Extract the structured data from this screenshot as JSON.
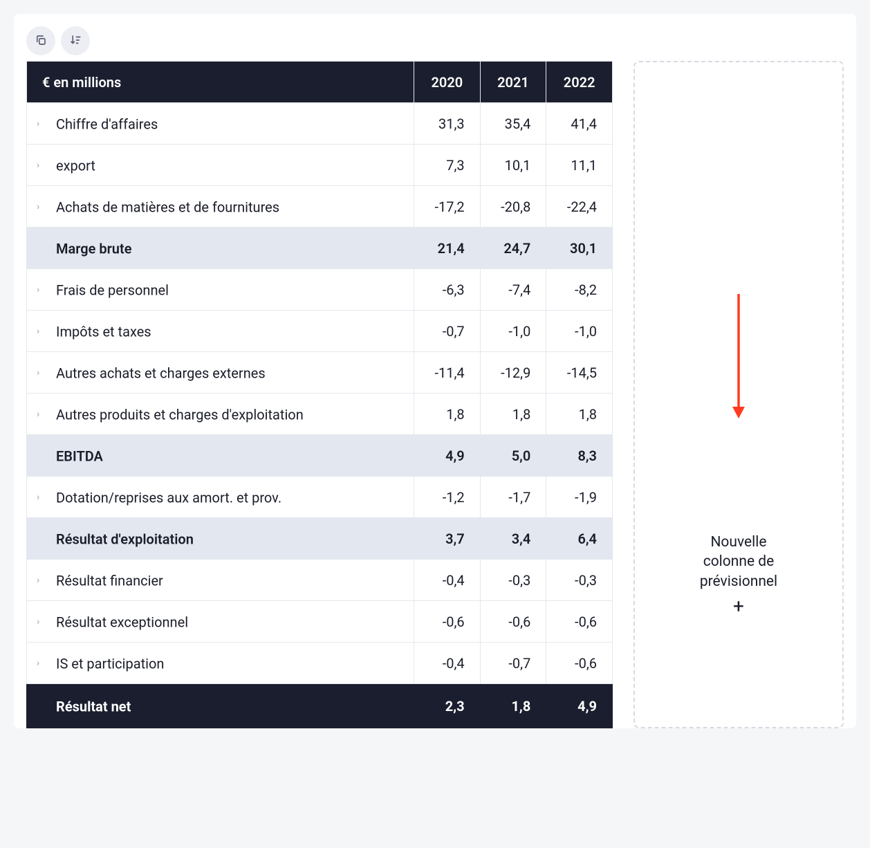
{
  "header": {
    "row_label": "€ en millions",
    "years": [
      "2020",
      "2021",
      "2022"
    ]
  },
  "rows": [
    {
      "type": "data",
      "label": "Chiffre d'affaires",
      "v": [
        "31,3",
        "35,4",
        "41,4"
      ]
    },
    {
      "type": "data",
      "label": "export",
      "v": [
        "7,3",
        "10,1",
        "11,1"
      ]
    },
    {
      "type": "data",
      "label": "Achats de matières et de fournitures",
      "v": [
        "-17,2",
        "-20,8",
        "-22,4"
      ]
    },
    {
      "type": "subtotal",
      "label": "Marge brute",
      "v": [
        "21,4",
        "24,7",
        "30,1"
      ]
    },
    {
      "type": "data",
      "label": "Frais de personnel",
      "v": [
        "-6,3",
        "-7,4",
        "-8,2"
      ]
    },
    {
      "type": "data",
      "label": "Impôts et taxes",
      "v": [
        "-0,7",
        "-1,0",
        "-1,0"
      ]
    },
    {
      "type": "data",
      "label": "Autres achats et charges externes",
      "v": [
        "-11,4",
        "-12,9",
        "-14,5"
      ]
    },
    {
      "type": "data",
      "label": "Autres produits et charges d'exploitation",
      "v": [
        "1,8",
        "1,8",
        "1,8"
      ]
    },
    {
      "type": "subtotal",
      "label": "EBITDA",
      "v": [
        "4,9",
        "5,0",
        "8,3"
      ]
    },
    {
      "type": "data",
      "label": "Dotation/reprises aux amort. et prov.",
      "v": [
        "-1,2",
        "-1,7",
        "-1,9"
      ]
    },
    {
      "type": "subtotal",
      "label": "Résultat d'exploitation",
      "v": [
        "3,7",
        "3,4",
        "6,4"
      ]
    },
    {
      "type": "data",
      "label": "Résultat financier",
      "v": [
        "-0,4",
        "-0,3",
        "-0,3"
      ]
    },
    {
      "type": "data",
      "label": "Résultat exceptionnel",
      "v": [
        "-0,6",
        "-0,6",
        "-0,6"
      ]
    },
    {
      "type": "data",
      "label": "IS et participation",
      "v": [
        "-0,4",
        "-0,7",
        "-0,6"
      ]
    },
    {
      "type": "grandtotal",
      "label": "Résultat net",
      "v": [
        "2,3",
        "1,8",
        "4,9"
      ]
    }
  ],
  "side": {
    "line1": "Nouvelle",
    "line2": "colonne de",
    "line3": "prévisionnel",
    "plus": "+"
  }
}
